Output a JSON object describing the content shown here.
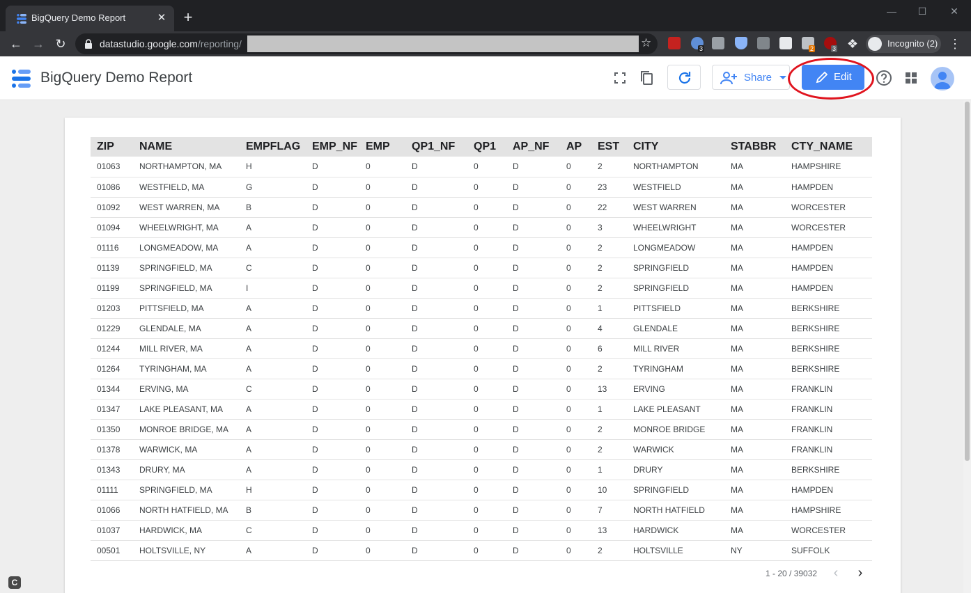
{
  "browser": {
    "tab_title": "BigQuery Demo Report",
    "tab_close": "✕",
    "new_tab": "+",
    "url_host": "datastudio.google.com",
    "url_path": "/reporting/",
    "incognito_label": "Incognito (2)",
    "extension_badges": [
      "3",
      "2",
      "3"
    ]
  },
  "app": {
    "report_title": "BigQuery Demo Report",
    "share_label": "Share",
    "edit_label": "Edit"
  },
  "table": {
    "columns": [
      "ZIP",
      "NAME",
      "EMPFLAG",
      "EMP_NF",
      "EMP",
      "QP1_NF",
      "QP1",
      "AP_NF",
      "AP",
      "EST",
      "CITY",
      "STABBR",
      "CTY_NAME"
    ],
    "rows": [
      [
        "01063",
        "NORTHAMPTON, MA",
        "H",
        "D",
        "0",
        "D",
        "0",
        "D",
        "0",
        "2",
        "NORTHAMPTON",
        "MA",
        "HAMPSHIRE"
      ],
      [
        "01086",
        "WESTFIELD, MA",
        "G",
        "D",
        "0",
        "D",
        "0",
        "D",
        "0",
        "23",
        "WESTFIELD",
        "MA",
        "HAMPDEN"
      ],
      [
        "01092",
        "WEST WARREN, MA",
        "B",
        "D",
        "0",
        "D",
        "0",
        "D",
        "0",
        "22",
        "WEST WARREN",
        "MA",
        "WORCESTER"
      ],
      [
        "01094",
        "WHEELWRIGHT, MA",
        "A",
        "D",
        "0",
        "D",
        "0",
        "D",
        "0",
        "3",
        "WHEELWRIGHT",
        "MA",
        "WORCESTER"
      ],
      [
        "01116",
        "LONGMEADOW, MA",
        "A",
        "D",
        "0",
        "D",
        "0",
        "D",
        "0",
        "2",
        "LONGMEADOW",
        "MA",
        "HAMPDEN"
      ],
      [
        "01139",
        "SPRINGFIELD, MA",
        "C",
        "D",
        "0",
        "D",
        "0",
        "D",
        "0",
        "2",
        "SPRINGFIELD",
        "MA",
        "HAMPDEN"
      ],
      [
        "01199",
        "SPRINGFIELD, MA",
        "I",
        "D",
        "0",
        "D",
        "0",
        "D",
        "0",
        "2",
        "SPRINGFIELD",
        "MA",
        "HAMPDEN"
      ],
      [
        "01203",
        "PITTSFIELD, MA",
        "A",
        "D",
        "0",
        "D",
        "0",
        "D",
        "0",
        "1",
        "PITTSFIELD",
        "MA",
        "BERKSHIRE"
      ],
      [
        "01229",
        "GLENDALE, MA",
        "A",
        "D",
        "0",
        "D",
        "0",
        "D",
        "0",
        "4",
        "GLENDALE",
        "MA",
        "BERKSHIRE"
      ],
      [
        "01244",
        "MILL RIVER, MA",
        "A",
        "D",
        "0",
        "D",
        "0",
        "D",
        "0",
        "6",
        "MILL RIVER",
        "MA",
        "BERKSHIRE"
      ],
      [
        "01264",
        "TYRINGHAM, MA",
        "A",
        "D",
        "0",
        "D",
        "0",
        "D",
        "0",
        "2",
        "TYRINGHAM",
        "MA",
        "BERKSHIRE"
      ],
      [
        "01344",
        "ERVING, MA",
        "C",
        "D",
        "0",
        "D",
        "0",
        "D",
        "0",
        "13",
        "ERVING",
        "MA",
        "FRANKLIN"
      ],
      [
        "01347",
        "LAKE PLEASANT, MA",
        "A",
        "D",
        "0",
        "D",
        "0",
        "D",
        "0",
        "1",
        "LAKE PLEASANT",
        "MA",
        "FRANKLIN"
      ],
      [
        "01350",
        "MONROE BRIDGE, MA",
        "A",
        "D",
        "0",
        "D",
        "0",
        "D",
        "0",
        "2",
        "MONROE BRIDGE",
        "MA",
        "FRANKLIN"
      ],
      [
        "01378",
        "WARWICK, MA",
        "A",
        "D",
        "0",
        "D",
        "0",
        "D",
        "0",
        "2",
        "WARWICK",
        "MA",
        "FRANKLIN"
      ],
      [
        "01343",
        "DRURY, MA",
        "A",
        "D",
        "0",
        "D",
        "0",
        "D",
        "0",
        "1",
        "DRURY",
        "MA",
        "BERKSHIRE"
      ],
      [
        "01111",
        "SPRINGFIELD, MA",
        "H",
        "D",
        "0",
        "D",
        "0",
        "D",
        "0",
        "10",
        "SPRINGFIELD",
        "MA",
        "HAMPDEN"
      ],
      [
        "01066",
        "NORTH HATFIELD, MA",
        "B",
        "D",
        "0",
        "D",
        "0",
        "D",
        "0",
        "7",
        "NORTH HATFIELD",
        "MA",
        "HAMPSHIRE"
      ],
      [
        "01037",
        "HARDWICK, MA",
        "C",
        "D",
        "0",
        "D",
        "0",
        "D",
        "0",
        "13",
        "HARDWICK",
        "MA",
        "WORCESTER"
      ],
      [
        "00501",
        "HOLTSVILLE, NY",
        "A",
        "D",
        "0",
        "D",
        "0",
        "D",
        "0",
        "2",
        "HOLTSVILLE",
        "NY",
        "SUFFOLK"
      ]
    ]
  },
  "pagination": {
    "label": "1 - 20 / 39032"
  },
  "corner_badge": "C",
  "colors": {
    "accent": "#4285f4",
    "highlight": "#e0141e",
    "chrome_dark": "#202124"
  }
}
